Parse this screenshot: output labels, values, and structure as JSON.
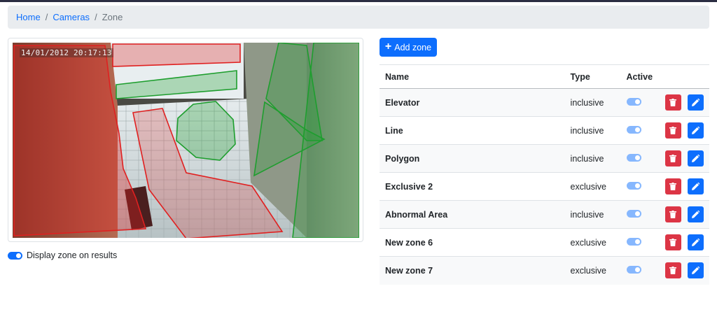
{
  "breadcrumb": {
    "home": "Home",
    "cameras": "Cameras",
    "current": "Zone"
  },
  "camera": {
    "timestamp": "14/01/2012 20:17:13"
  },
  "display_toggle": {
    "label": "Display zone on results",
    "checked": true
  },
  "add_zone": {
    "label": "Add zone"
  },
  "table": {
    "headers": {
      "name": "Name",
      "type": "Type",
      "active": "Active"
    },
    "rows": [
      {
        "name": "Elevator",
        "type": "inclusive",
        "active": true
      },
      {
        "name": "Line",
        "type": "inclusive",
        "active": true
      },
      {
        "name": "Polygon",
        "type": "inclusive",
        "active": true
      },
      {
        "name": "Exclusive 2",
        "type": "exclusive",
        "active": true
      },
      {
        "name": "Abnormal Area",
        "type": "inclusive",
        "active": true
      },
      {
        "name": "New zone 6",
        "type": "exclusive",
        "active": true
      },
      {
        "name": "New zone 7",
        "type": "exclusive",
        "active": true
      }
    ]
  },
  "colors": {
    "primary": "#0d6efd",
    "danger": "#dc3545",
    "exclusive_zone": "#e02020",
    "inclusive_zone": "#1e9e2e"
  },
  "icons": {
    "add": "plus-icon",
    "delete": "trash-icon",
    "edit": "pencil-icon",
    "toggle": "toggle-switch-icon"
  }
}
